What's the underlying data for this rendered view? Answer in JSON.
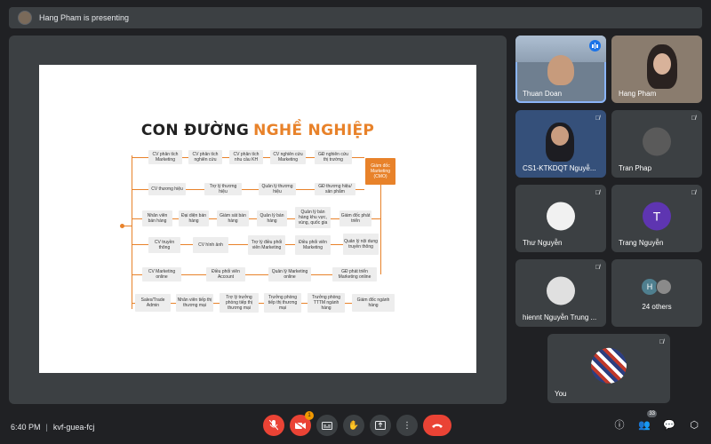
{
  "top_bar": {
    "presenter_text": "Hang Pham is presenting"
  },
  "slide": {
    "title_part1": "CON ĐƯỜNG",
    "title_part2": "NGHỀ NGHIỆP",
    "cmo_label": "Giám đốc Marketing (CMO)",
    "rows": [
      [
        "CV phân tích Marketing",
        "CV phân tích nghiên cứu",
        "CV phân tích nhu cầu KH",
        "CV nghiên cứu Marketing",
        "GĐ nghiên cứu thị trường"
      ],
      [
        "CV thương hiệu",
        "Trợ lý thương hiệu",
        "Quản lý thương hiệu",
        "GĐ thương hiệu/ sản phẩm"
      ],
      [
        "Nhân viên bán hàng",
        "Đại diện bán hàng",
        "Giám sát bán hàng",
        "Quản lý bán hàng",
        "Quản lý bán hàng khu vực, vùng, quốc gia",
        "Giám đốc phát triển"
      ],
      [
        "CV truyền thông",
        "CV hình ảnh",
        "Trợ lý điều phối viên Marketing",
        "Điều phối viên Marketing",
        "Quản lý nội dung truyền thông"
      ],
      [
        "CV Marketing online",
        "Điều phối viên Account",
        "Quản lý Marketing online",
        "GĐ phát triển Marketing online"
      ],
      [
        "Sales/Trade Admin",
        "Nhân viên tiếp thị thương mại",
        "Trợ lý trưởng phòng tiếp thị thương mại",
        "Trưởng phòng tiếp thị thương mại",
        "Trưởng phòng TTTM ngành hàng",
        "Giám đốc ngành hàng"
      ]
    ]
  },
  "participants": [
    {
      "name": "Thuan Doan",
      "speaking": true
    },
    {
      "name": "Hang Pham"
    },
    {
      "name": "CS1-KTKDQT Nguyễ..."
    },
    {
      "name": "Tran Phap"
    },
    {
      "name": "Thư Nguyễn"
    },
    {
      "name": "Trang Nguyễn",
      "initial": "T"
    },
    {
      "name": "hiennt Nguyễn Trung ..."
    },
    {
      "name": "24 others",
      "initial": "H"
    },
    {
      "name": "You"
    }
  ],
  "bottom_bar": {
    "time": "6:40 PM",
    "meeting_code": "kvf-guea-fcj",
    "notification_count": "1",
    "people_count": "33"
  },
  "colors": {
    "accent_orange": "#e8822a",
    "end_call_red": "#ea4335",
    "active_blue": "#1a73e8"
  }
}
